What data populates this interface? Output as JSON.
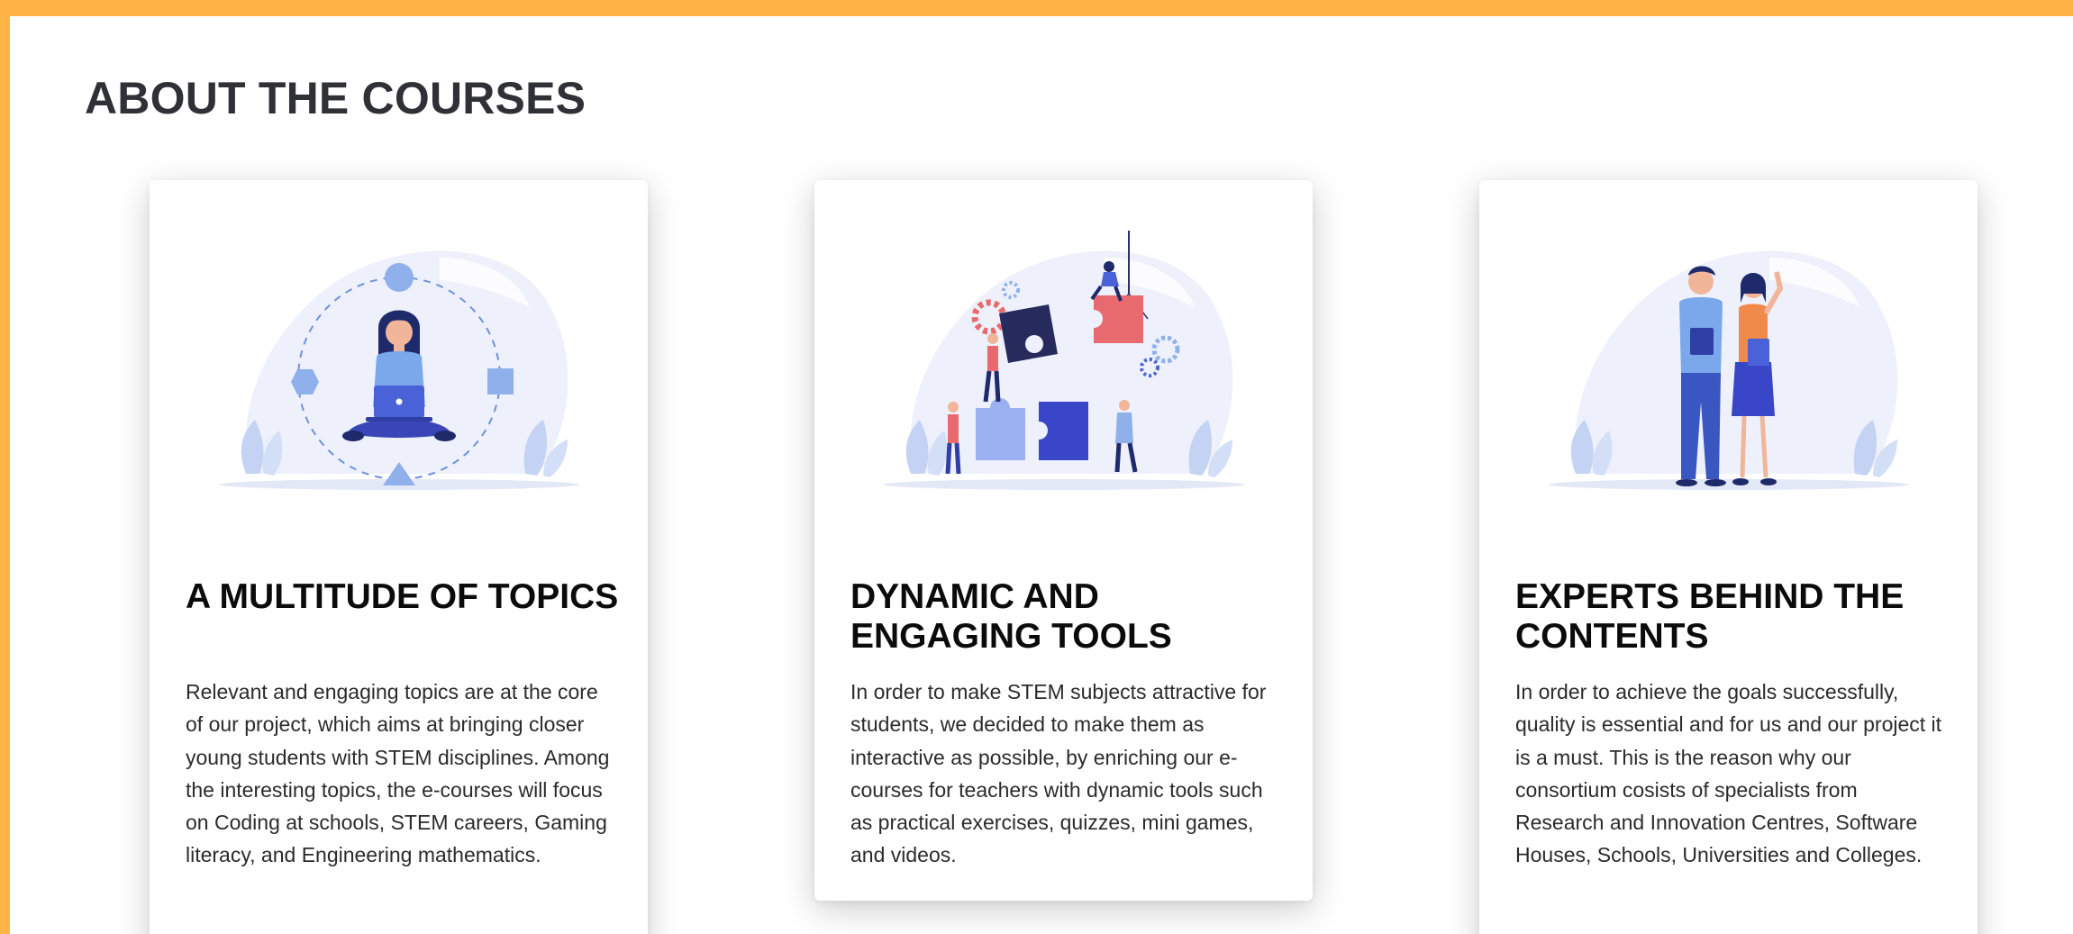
{
  "section": {
    "title": "ABOUT THE COURSES"
  },
  "colors": {
    "frame": "#ffb545",
    "accent_blue": "#4a62d8",
    "accent_coral": "#e86a6f"
  },
  "cards": [
    {
      "illustration": "person-meditating-with-laptop-illustration",
      "title": "A MULTITUDE OF TOPICS",
      "text": "Relevant and engaging topics are at the core of our project, which aims at bringing closer young students with STEM disciplines. Among the interesting topics, the e-courses will focus on Coding at schools, STEM careers, Gaming literacy, and Engineering mathematics."
    },
    {
      "illustration": "team-assembling-puzzle-illustration",
      "title": "DYNAMIC AND ENGAGING TOOLS",
      "text": "In order to make STEM subjects attractive for students, we decided to make them as interactive as possible, by enriching our e-courses for teachers with dynamic tools such as practical exercises, quizzes, mini games, and videos."
    },
    {
      "illustration": "two-experts-standing-illustration",
      "title": "EXPERTS BEHIND THE CONTENTS",
      "text": "In order to achieve the goals successfully, quality is essential and for us and our project it is a must. This is the reason why our consortium cosists of specialists from Research and Innovation Centres, Software Houses, Schools, Universities and Colleges."
    }
  ]
}
